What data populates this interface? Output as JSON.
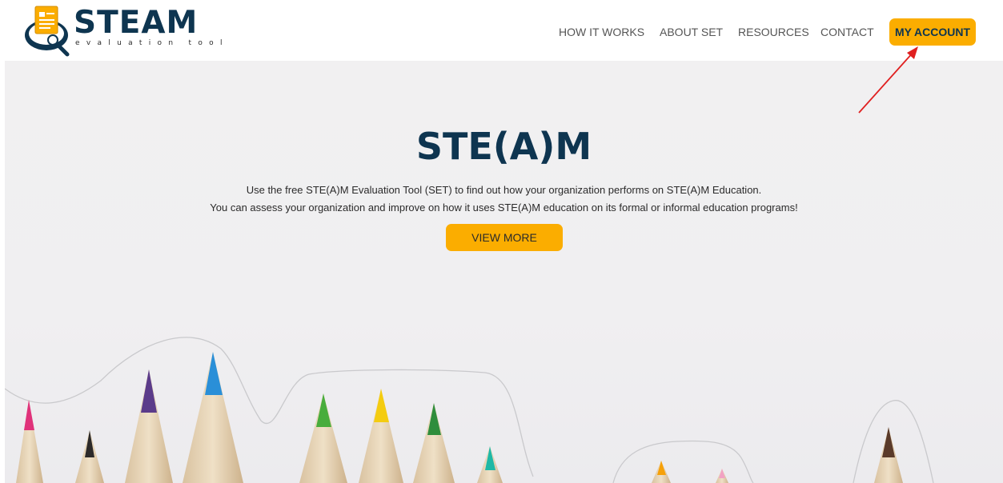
{
  "brand": {
    "name": "STEAM",
    "tagline": "evaluation tool"
  },
  "nav": {
    "items": [
      {
        "label": "HOW IT WORKS"
      },
      {
        "label": "ABOUT SET"
      },
      {
        "label": "RESOURCES"
      },
      {
        "label": "CONTACT"
      }
    ],
    "account_label": "MY ACCOUNT"
  },
  "hero": {
    "title": "STE(A)M",
    "line1": "Use the free STE(A)M Evaluation Tool (SET) to find out how your organization performs on STE(A)M Education.",
    "line2": "You can assess your organization and improve on how it uses STE(A)M education on its formal or informal education programs!",
    "button_label": "VIEW MORE"
  },
  "colors": {
    "accent": "#fbad00",
    "brand_dark": "#0e3550",
    "annotation_arrow": "#e02020"
  },
  "icons": {
    "logo": "document-magnifier-icon"
  }
}
